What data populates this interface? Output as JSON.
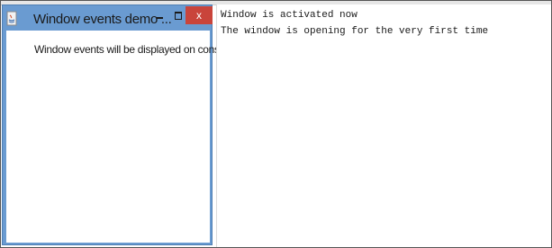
{
  "window": {
    "title": "Window events demo ...",
    "minimize_icon": "minimize-icon",
    "maximize_icon": "maximize-icon",
    "close_label": "x",
    "app_icon": "java-icon",
    "message": "Window events will be displayed on console"
  },
  "console": {
    "lines": [
      "Window is activated now",
      "The window is opening for the very first time"
    ]
  },
  "colors": {
    "window_frame": "#6a9bd1",
    "close_button": "#c9443b"
  }
}
